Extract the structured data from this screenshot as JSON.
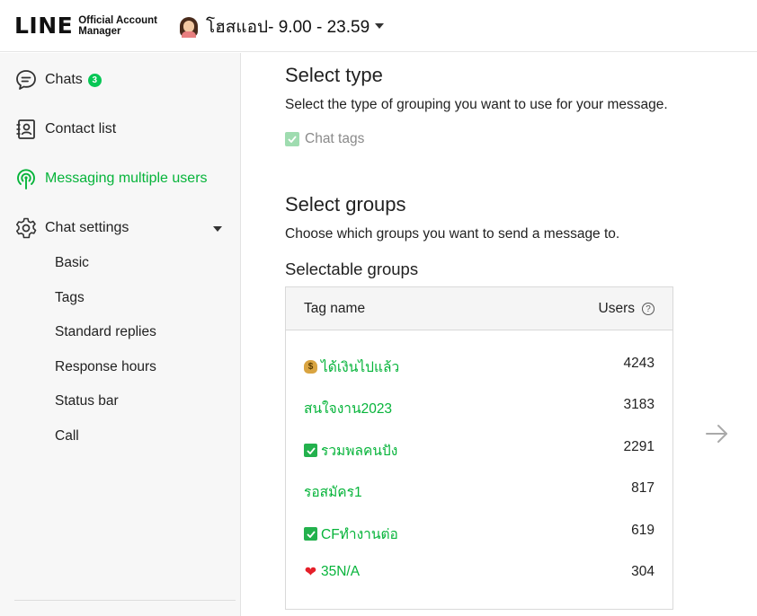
{
  "header": {
    "logo_main": "LINE",
    "logo_sub_1": "Official Account",
    "logo_sub_2": "Manager",
    "account_name": "โฮสแอป- 9.00 - 23.59"
  },
  "sidebar": {
    "chats_label": "Chats",
    "chats_badge": "3",
    "contact_list_label": "Contact list",
    "messaging_label": "Messaging multiple users",
    "chat_settings_label": "Chat settings",
    "sub_items": [
      "Basic",
      "Tags",
      "Standard replies",
      "Response hours",
      "Status bar",
      "Call"
    ]
  },
  "main": {
    "select_type_title": "Select type",
    "select_type_desc": "Select the type of grouping you want to use for your message.",
    "chat_tags_label": "Chat tags",
    "select_groups_title": "Select groups",
    "select_groups_desc": "Choose which groups you want to send a message to.",
    "selectable_groups_title": "Selectable groups",
    "table": {
      "col_tag": "Tag name",
      "col_users": "Users",
      "rows": [
        {
          "icon": "money-bag-icon",
          "name": "ได้เงินไปแล้ว",
          "users": "4243"
        },
        {
          "icon": "",
          "name": "สนใจงาน2023",
          "users": "3183"
        },
        {
          "icon": "check-mark-icon",
          "name": "รวมพลคนปัง",
          "users": "2291"
        },
        {
          "icon": "",
          "name": "รอสมัคร1",
          "users": "817"
        },
        {
          "icon": "check-mark-icon",
          "name": "CFทำงานต่อ",
          "users": "619"
        },
        {
          "icon": "heart-icon",
          "name": "35N/A",
          "users": "304"
        }
      ]
    }
  },
  "colors": {
    "brand_green": "#06b43a",
    "badge_green": "#06c755",
    "checkbox_disabled": "#9fdcb0"
  }
}
